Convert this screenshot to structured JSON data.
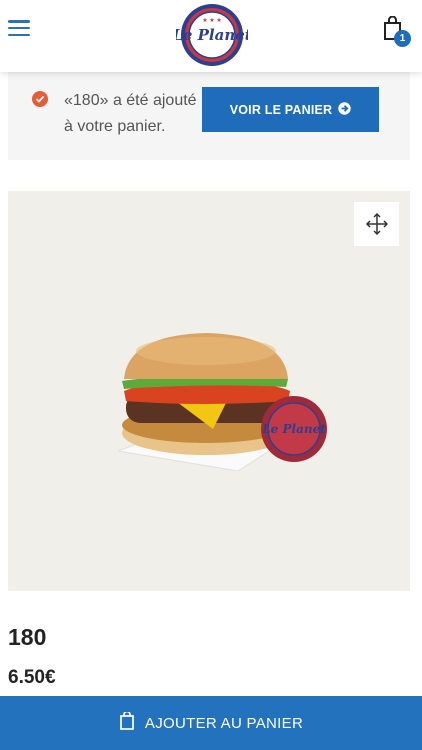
{
  "header": {
    "logo_text": "Le Planet",
    "cart_count": "1"
  },
  "notice": {
    "message": "«180» a été ajouté à votre panier.",
    "view_cart_label": "VOIR LE PANIER"
  },
  "product": {
    "name": "180",
    "price": "6.50€",
    "add_to_cart_label": "AJOUTER AU PANIER"
  },
  "colors": {
    "accent": "#1f6dba",
    "check": "#e45d38",
    "image_bg": "#f1efea"
  },
  "icons": {
    "menu": "hamburger-menu-icon",
    "cart": "shopping-bag-icon",
    "check": "check-circle-icon",
    "arrow": "arrow-right-icon",
    "zoom": "expand-arrows-icon",
    "add_cart": "shopping-bag-icon"
  }
}
